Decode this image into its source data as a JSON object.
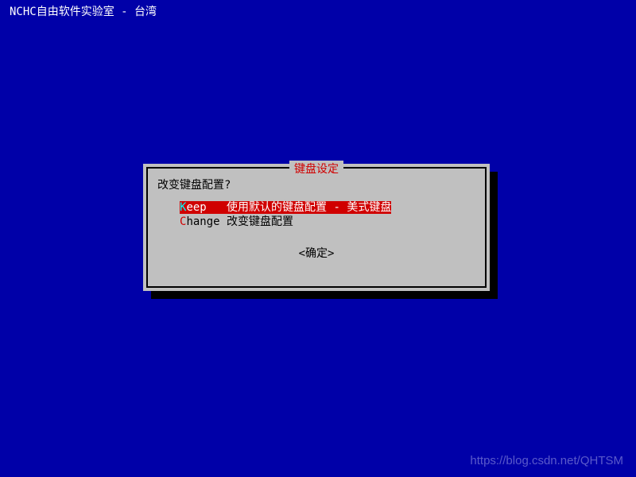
{
  "header": {
    "title": "NCHC自由软件实验室 - 台湾"
  },
  "dialog": {
    "title": "键盘设定",
    "prompt": "改变键盘配置?",
    "options": [
      {
        "key": "K",
        "key_rest": "eep",
        "label": "使用默认的键盘配置 - 美式键盘",
        "selected": true
      },
      {
        "key": "C",
        "key_rest": "hange",
        "label": "改变键盘配置",
        "selected": false
      }
    ],
    "confirm": "<确定>"
  },
  "watermark": "https://blog.csdn.net/QHTSM"
}
